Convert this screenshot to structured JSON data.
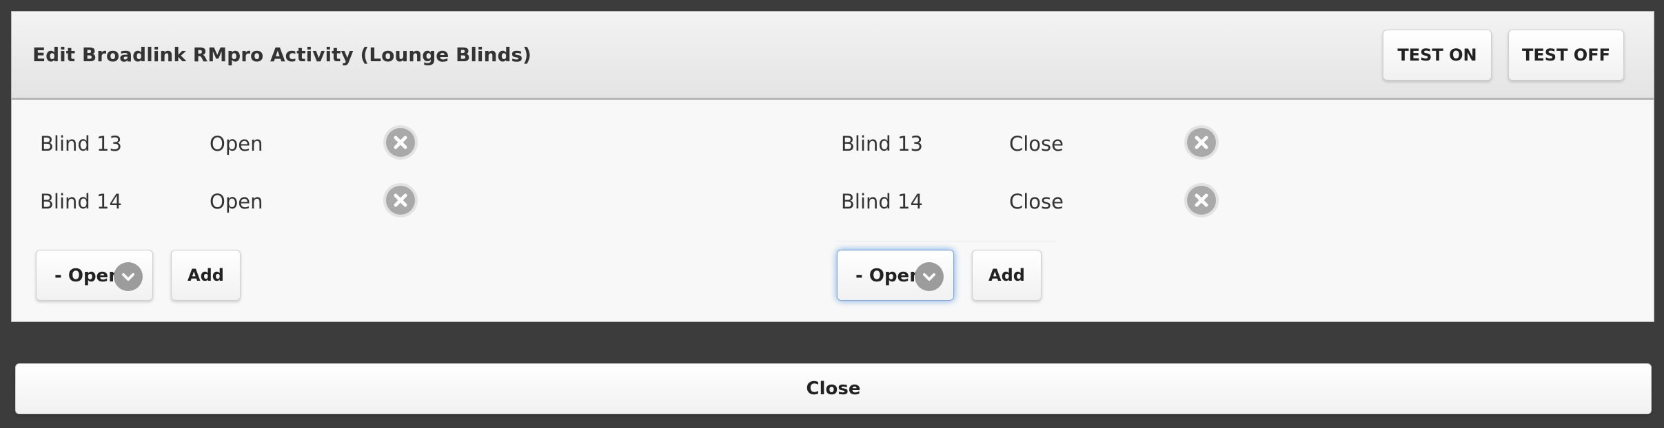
{
  "dialog": {
    "title": "Edit Broadlink RMpro Activity (Lounge Blinds)",
    "test_on_label": "TEST ON",
    "test_off_label": "TEST OFF"
  },
  "on_commands": {
    "rows": [
      {
        "device": "Blind 13",
        "command": "Open"
      },
      {
        "device": "Blind 14",
        "command": "Open"
      }
    ],
    "select_value": "- Open",
    "add_label": "Add"
  },
  "off_commands": {
    "rows": [
      {
        "device": "Blind 13",
        "command": "Close"
      },
      {
        "device": "Blind 14",
        "command": "Close"
      }
    ],
    "select_value": "- Open",
    "add_label": "Add"
  },
  "close_label": "Close",
  "icons": {
    "delete": "delete-icon",
    "dropdown": "chevron-down-icon"
  },
  "colors": {
    "background": "#3c3c3c",
    "panel": "#f8f8f8",
    "icon_gray": "#a9a9a9",
    "focus_blue": "#6fa2dc"
  }
}
